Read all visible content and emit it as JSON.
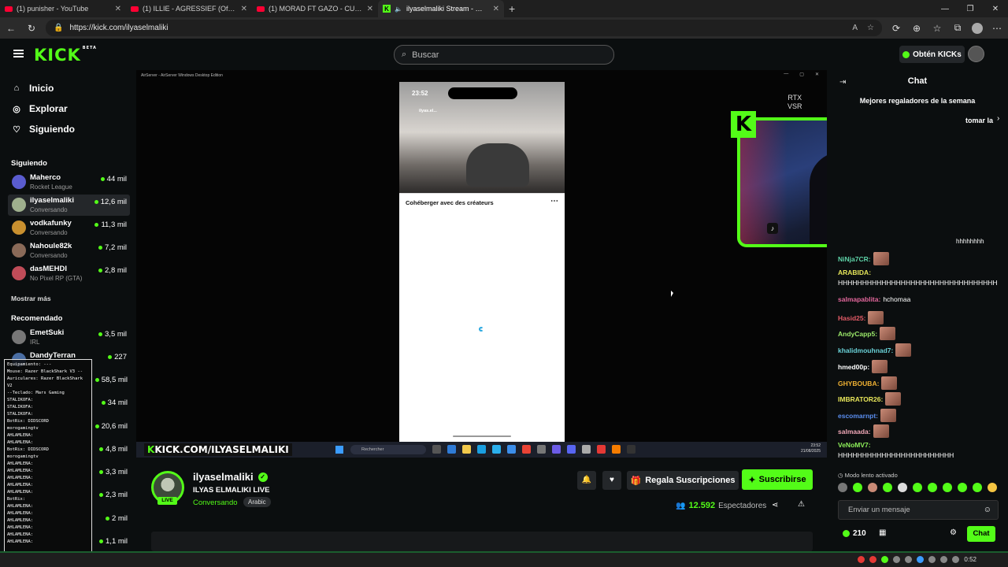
{
  "browser": {
    "tabs": [
      {
        "label": "(1) punisher - YouTube",
        "icon": "youtube-icon"
      },
      {
        "label": "(1) ILLIE - AGRESSIEF (Official Vid",
        "icon": "youtube-icon"
      },
      {
        "label": "(1) MORAD FT GAZO - CUÍDATE",
        "icon": "youtube-icon"
      },
      {
        "label": "ilyaselmaliki Stream - Watch",
        "icon": "kick-icon"
      }
    ],
    "url": "https://kick.com/ilyaselmaliki"
  },
  "header": {
    "logo": "KICK",
    "logo_badge": "BETA",
    "search_placeholder": "Buscar",
    "kicks_button": "Obtén KICKs"
  },
  "sidebar": {
    "nav": [
      {
        "label": "Inicio",
        "icon": "home-icon"
      },
      {
        "label": "Explorar",
        "icon": "compass-icon"
      },
      {
        "label": "Siguiendo",
        "icon": "heart-icon"
      }
    ],
    "following_title": "Siguiendo",
    "following": [
      {
        "name": "Maherco",
        "category": "Rocket League",
        "viewers": "44 mil",
        "color": "#5a5ccf"
      },
      {
        "name": "ilyaselmaliki",
        "category": "Conversando",
        "viewers": "12,6 mil",
        "color": "#9fb08e"
      },
      {
        "name": "vodkafunky",
        "category": "Conversando",
        "viewers": "11,3 mil",
        "color": "#c9902f"
      },
      {
        "name": "Nahoule82k",
        "category": "Conversando",
        "viewers": "7,2 mil",
        "color": "#8a6a58"
      },
      {
        "name": "dasMEHDI",
        "category": "No Pixel RP (GTA)",
        "viewers": "2,8 mil",
        "color": "#c04c58"
      }
    ],
    "show_more": "Mostrar más",
    "recommended_title": "Recomendado",
    "recommended": [
      {
        "name": "EmetSuki",
        "category": "IRL",
        "viewers": "3,5 mil",
        "color": "#777"
      },
      {
        "name": "DandyTerran",
        "category": "",
        "viewers": "227",
        "color": "#4a6ea3"
      }
    ],
    "recommended_viewers": [
      "58,5 mil",
      "34 mil",
      "20,6 mil",
      "4,8 mil",
      "3,3 mil",
      "2,3 mil",
      "2 mil",
      "1,1 mil"
    ],
    "obs_overlay": [
      "Equipamiento: ---",
      "Mouse: Razer BlackShark V3 --",
      "Auriculares: Razer BlackShark V2",
      "--Teclado: Mars Gaming",
      "STALIKOFA:",
      "STALIKOFA:",
      "STALIKOFA:",
      "BotRix: DIDSCORD",
      "morogamingtv",
      "AHLAMLENA:",
      "AHLAMLENA:",
      "BotRix: DIDSCORD",
      "morogamingtv",
      "AHLAMLENA:",
      "AHLAMLENA:",
      "AHLAMLENA:",
      "AHLAMLENA:",
      "AHLAMLENA:",
      "BotRix:",
      "AHLAMLENA:",
      "AHLAMLENA:",
      "AHLAMLENA:",
      "AHLAMLENA:",
      "AHLAMLENA:",
      "AHLAMLENA:"
    ]
  },
  "player": {
    "airserver_title": "AirServer - AirServer Windows Desktop Edition",
    "phone_time": "23:52",
    "phone_user": "ilyas.el...",
    "phone_sheet_title": "Cohéberger avec des créateurs",
    "rtx_label": "RTX",
    "vsr_label": "VSR",
    "overlay_url": "KICK.COM/ILYASELMALIKI",
    "taskbar_search": "Rechercher"
  },
  "stream": {
    "name": "ilyaselmaliki",
    "title": "ILYAS ELMALIKI LIVE",
    "category": "Conversando",
    "tag": "Arabic",
    "live_label": "LIVE",
    "gift_button": "Regala Suscripciones",
    "subscribe_button": "Suscribirse",
    "viewers": "12.592",
    "viewers_label": "Espectadores"
  },
  "chat": {
    "title": "Chat",
    "top_gifters": "Mejores regaladores de la semana",
    "gifters_partial": "tomar la",
    "partial_line": "hhhhhhhh",
    "messages": [
      {
        "user": "NiNja7CR:",
        "text": "",
        "color": "#5ed3a8",
        "emote": true
      },
      {
        "user": "ARABIDA:",
        "text": "",
        "color": "#e6e65a",
        "emote": false
      },
      {
        "user": "",
        "text": "HHHHHHHHHHHHHHHHHHHHHHHHHHHHHHHHH",
        "color": "#fff",
        "emote": false
      },
      {
        "user": "salmapablita:",
        "text": "hchomaa",
        "color": "#e3679c",
        "emote": false
      },
      {
        "user": "Hasid25:",
        "text": "",
        "color": "#e35b67",
        "emote": true
      },
      {
        "user": "AndyCapp5:",
        "text": "",
        "color": "#9be86a",
        "emote": true
      },
      {
        "user": "khalidmouhnad7:",
        "text": "",
        "color": "#6ad2d8",
        "emote": true
      },
      {
        "user": "hmed00p:",
        "text": "",
        "color": "#ffffff",
        "emote": true
      },
      {
        "user": "GHYBOUBA:",
        "text": "",
        "color": "#f0b132",
        "emote": true
      },
      {
        "user": "IMBRATOR26:",
        "text": "",
        "color": "#e8e65a",
        "emote": true
      },
      {
        "user": "escomarnpt:",
        "text": "",
        "color": "#5a8ef0",
        "emote": true
      },
      {
        "user": "salmaada:",
        "text": "",
        "color": "#f0a7b7",
        "emote": true
      },
      {
        "user": "VeNoMV7:",
        "text": "",
        "color": "#8ef05a",
        "emote": false
      },
      {
        "user": "",
        "text": "HHHHHHHHHHHHHHHHHHHHHHHH",
        "color": "#fff",
        "emote": false
      }
    ],
    "slow_mode": "Modo lento activado",
    "input_placeholder": "Enviar un mensaje",
    "kicks_balance": "210",
    "send_button": "Chat"
  },
  "system": {
    "clock": "0:52",
    "date": "21/08/2025",
    "small_time": "23:52"
  }
}
